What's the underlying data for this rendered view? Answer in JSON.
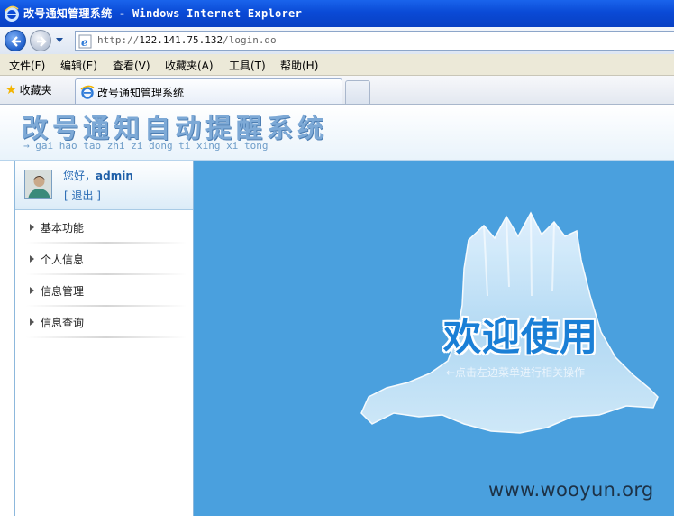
{
  "window": {
    "title": "改号通知管理系统 - Windows Internet Explorer"
  },
  "address_bar": {
    "scheme": "http://",
    "host": "122.141.75.132",
    "path": "/login.do"
  },
  "menu": {
    "items": [
      "文件(F)",
      "编辑(E)",
      "查看(V)",
      "收藏夹(A)",
      "工具(T)",
      "帮助(H)"
    ]
  },
  "favorites": {
    "label": "收藏夹"
  },
  "tab": {
    "title": "改号通知管理系统"
  },
  "header": {
    "title": "改号通知自动提醒系统",
    "subtitle": "→ gai hao tao zhi zi dong ti xing xi tong"
  },
  "user": {
    "greeting": "您好，",
    "name": "admin",
    "logout": "[ 退出 ]"
  },
  "sidebar": {
    "items": [
      {
        "label": "基本功能"
      },
      {
        "label": "个人信息"
      },
      {
        "label": "信息管理"
      },
      {
        "label": "信息查询"
      }
    ]
  },
  "main": {
    "welcome": "欢迎使用",
    "hint": "←点击左边菜单进行相关操作",
    "background_color": "#4aa0de"
  },
  "watermark": {
    "text": "www.wooyun.org"
  },
  "icons": {
    "title_logo": "ie-logo-icon",
    "back": "back-arrow-icon",
    "forward": "forward-arrow-icon",
    "page": "ie-page-icon",
    "favorites": "star-icon"
  }
}
